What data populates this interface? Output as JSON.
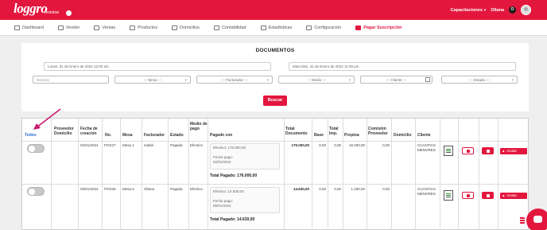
{
  "header": {
    "logo_text": "loggro",
    "logo_sub": "restobar",
    "capacitaciones": "Capacitaciones",
    "user_name": "Oliana",
    "user_initial": "O"
  },
  "nav": [
    {
      "label": "Dashboard",
      "icon": "dashboard-icon"
    },
    {
      "label": "Vender",
      "icon": "cart-icon"
    },
    {
      "label": "Ventas",
      "icon": "tag-icon"
    },
    {
      "label": "Productos",
      "icon": "box-icon"
    },
    {
      "label": "Domicilios",
      "icon": "delivery-icon"
    },
    {
      "label": "Contabilidad",
      "icon": "ledger-icon"
    },
    {
      "label": "Estadísticas",
      "icon": "chart-icon"
    },
    {
      "label": "Configuración",
      "icon": "gear-icon"
    },
    {
      "label": "Pagar Suscripción",
      "icon": "card-icon",
      "active": true
    }
  ],
  "filters": {
    "title": "DOCUMENTOS",
    "date_from": "Lunes, 01 de Enero de 2024 12:00 am",
    "date_to": "Miercoles, 31 de Enero de 2024 11:00 pm",
    "numero_placeholder": "Número",
    "mesa": "--- Mesa ---",
    "facturador": "--- Facturador ---",
    "medio": "--- Medio ---",
    "cliente": "--- Cliente ---",
    "estado": "--- Estado ---",
    "search_label": "Buscar"
  },
  "table": {
    "headers": {
      "todos": "Todos",
      "proveedor": "Proveedor Domicilio",
      "fecha": "Fecha de creación",
      "no": "No.",
      "mesa": "Mesa",
      "facturador": "Facturador",
      "estado": "Estado",
      "medio": "Medio de pago",
      "pagado": "Pagado con",
      "total": "Total Documento",
      "base": "Base",
      "imp": "Total Imp.",
      "propina": "Propina",
      "comision": "Comisión Proveedor",
      "domicilio": "Domicilio",
      "cliente": "Cliente"
    },
    "rows": [
      {
        "fecha": "02/01/2024",
        "no": "POS27",
        "mesa": "Mesa 1",
        "facturador": "Isabel",
        "estado": "Pagada",
        "medio": "Efectivo",
        "pay_line1": "Efectivo: 176.000,00",
        "pay_line2": "Fecha pago:",
        "pay_line3": "02/01/2024",
        "total_paid": "Total Pagado: 176.000,00",
        "total": "176.000,00",
        "base": "0,00",
        "imp": "0,00",
        "propina": "16.000,00",
        "comision": "0,00",
        "cliente1": "CUANTIAS",
        "cliente2": "MENORES",
        "anular": "Anular"
      },
      {
        "fecha": "05/01/2024",
        "no": "POS28",
        "mesa": "Mesa 6",
        "facturador": "Oliana",
        "estado": "Pagada",
        "medio": "Efectivo",
        "pay_line1": "Efectivo: 14.630,00",
        "pay_line2": "Fecha pago:",
        "pay_line3": "05/01/2024",
        "total_paid": "Total Pagado: 14.630,00",
        "total": "14.630,00",
        "base": "0,00",
        "imp": "0,00",
        "propina": "1.330,00",
        "comision": "0,00",
        "cliente1": "CUANTIAS",
        "cliente2": "MENORES",
        "anular": "Anular"
      }
    ]
  },
  "colors": {
    "brand": "#e3173e",
    "link": "#2a6ad1"
  }
}
